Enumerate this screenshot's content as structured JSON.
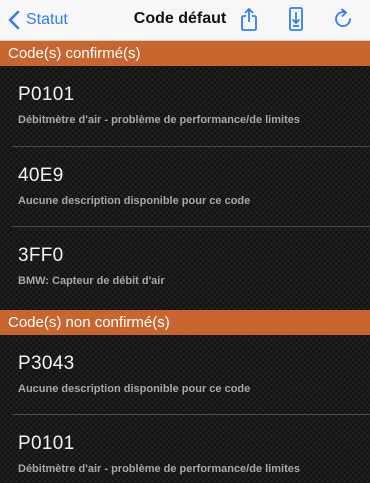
{
  "navbar": {
    "back_label": "Statut",
    "title": "Code défaut",
    "icons": [
      "share-icon",
      "download-icon",
      "refresh-icon"
    ],
    "accent": "#2f7df6"
  },
  "sections": [
    {
      "title": "Code(s) confirmé(s)",
      "items": [
        {
          "code": "P0101",
          "description": "Débitmètre d'air - problème de performance/de limites"
        },
        {
          "code": "40E9",
          "description": "Aucune description disponible pour ce code"
        },
        {
          "code": "3FF0",
          "description": "BMW: Capteur de débit d'air"
        }
      ]
    },
    {
      "title": "Code(s) non confirmé(s)",
      "items": [
        {
          "code": "P3043",
          "description": "Aucune description disponible pour ce code"
        },
        {
          "code": "P0101",
          "description": "Débitmètre d'air - problème de performance/de limites"
        }
      ]
    }
  ],
  "colors": {
    "section_header": "#c9662f",
    "background": "#1a1a1a"
  }
}
